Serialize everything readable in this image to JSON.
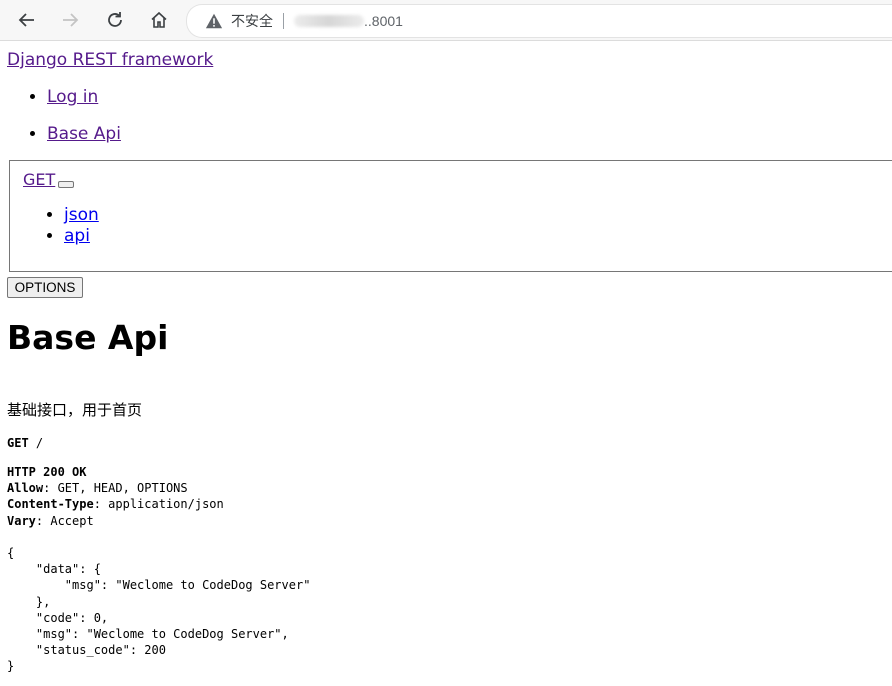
{
  "browser": {
    "security_label": "不安全",
    "url_visible_tail": "..8001"
  },
  "page": {
    "brand": "Django REST framework",
    "nav": [
      "Log in",
      "Base Api"
    ],
    "get_label": "GET",
    "formats": [
      "json",
      "api"
    ],
    "options_label": "OPTIONS",
    "title": "Base Api",
    "description": "基础接口，用于首页"
  },
  "request": {
    "method": "GET",
    "path": "/"
  },
  "response": {
    "status_line": "HTTP 200 OK",
    "headers": [
      {
        "name": "Allow",
        "value": "GET, HEAD, OPTIONS"
      },
      {
        "name": "Content-Type",
        "value": "application/json"
      },
      {
        "name": "Vary",
        "value": "Accept"
      }
    ],
    "body_lines": [
      "{",
      "    \"data\": {",
      "        \"msg\": \"Weclome to CodeDog Server\"",
      "    },",
      "    \"code\": 0,",
      "    \"msg\": \"Weclome to CodeDog Server\",",
      "    \"status_code\": 200",
      "}"
    ]
  }
}
